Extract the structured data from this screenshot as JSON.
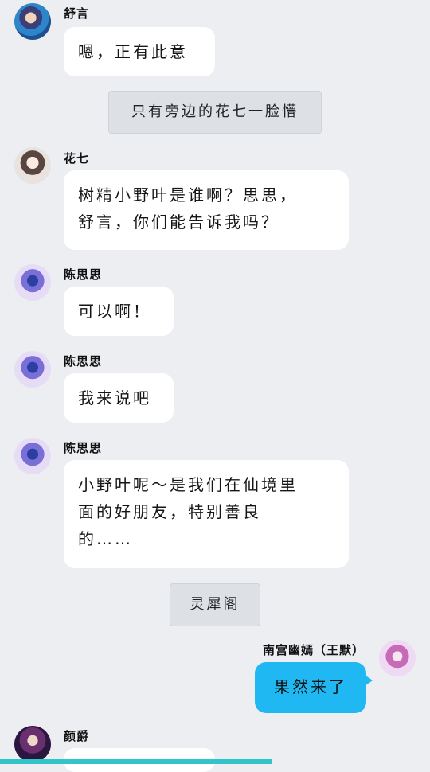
{
  "messages": [
    {
      "id": "m1",
      "sender": "舒言",
      "text": "嗯，正有此意",
      "side": "left",
      "avatar_icon": "avatar-shuyan-icon"
    },
    {
      "id": "s1",
      "type": "system",
      "text": "只有旁边的花七一脸懵"
    },
    {
      "id": "m2",
      "sender": "花七",
      "text": "树精小野叶是谁啊？思思，\n舒言，你们能告诉我吗？",
      "side": "left",
      "avatar_icon": "avatar-huaqi-icon"
    },
    {
      "id": "m3",
      "sender": "陈思思",
      "text": "可以啊！",
      "side": "left",
      "avatar_icon": "avatar-chensisi-icon"
    },
    {
      "id": "m4",
      "sender": "陈思思",
      "text": "我来说吧",
      "side": "left",
      "avatar_icon": "avatar-chensisi-icon"
    },
    {
      "id": "m5",
      "sender": "陈思思",
      "text": "小野叶呢～是我们在仙境里\n面的好朋友，特别善良\n的……",
      "side": "left",
      "avatar_icon": "avatar-chensisi-icon"
    },
    {
      "id": "s2",
      "type": "system",
      "text": "灵犀阁"
    },
    {
      "id": "m6",
      "sender": "南宫幽嫣（王默）",
      "text": "果然来了",
      "side": "right",
      "avatar_icon": "avatar-nangong-icon"
    },
    {
      "id": "m7",
      "sender": "颜爵",
      "text": "",
      "side": "left",
      "avatar_icon": "avatar-yanjue-icon"
    }
  ],
  "colors": {
    "background": "#edeef1",
    "bubble": "#ffffff",
    "my_bubble": "#1fb8f2",
    "system_bg": "#dde0e5",
    "bottom_bar": "#31c4c9"
  }
}
